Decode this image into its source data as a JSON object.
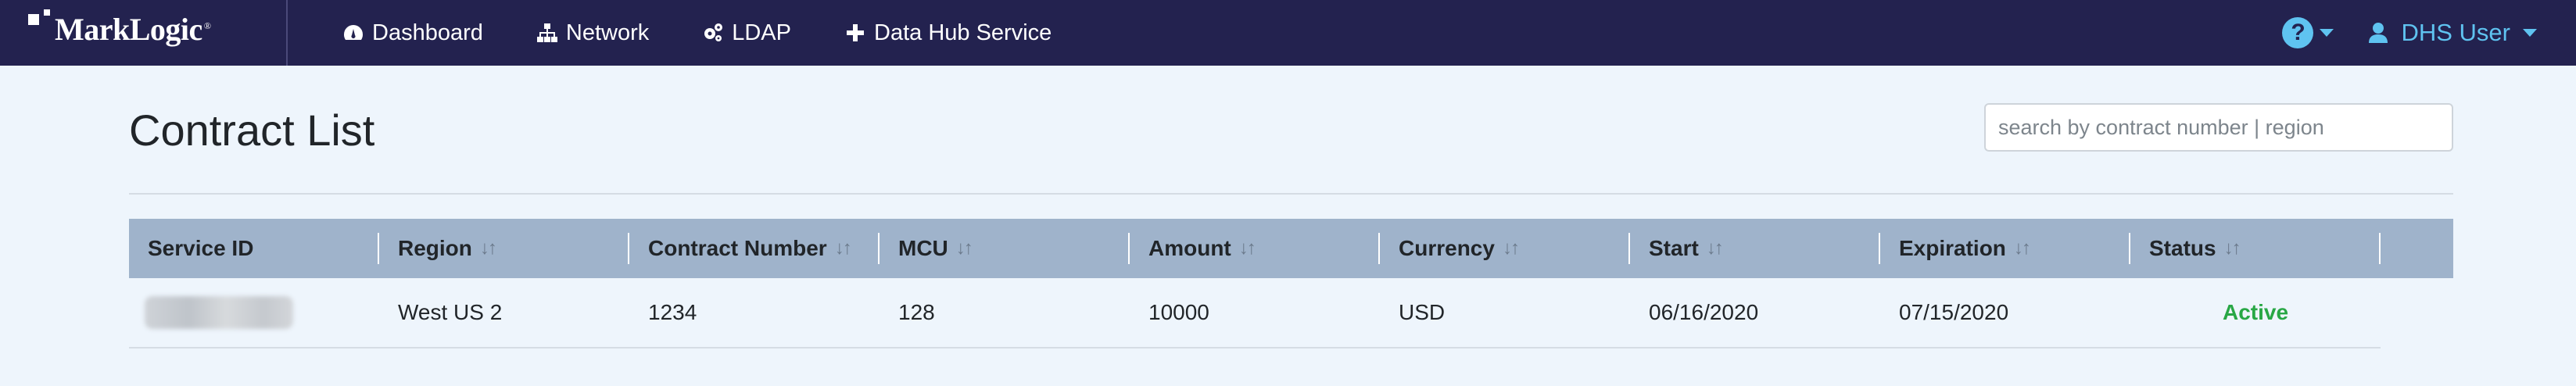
{
  "app": {
    "brand": "MarkLogic",
    "brand_mark": "®"
  },
  "nav": {
    "items": [
      {
        "label": "Dashboard",
        "icon": "tachometer-icon"
      },
      {
        "label": "Network",
        "icon": "sitemap-icon"
      },
      {
        "label": "LDAP",
        "icon": "cogs-icon"
      },
      {
        "label": "Data Hub Service",
        "icon": "plus-icon"
      }
    ],
    "help_icon": "question-circle-icon",
    "user_label": "DHS User",
    "user_icon": "user-icon"
  },
  "page": {
    "title": "Contract List",
    "search_placeholder": "search by contract number | region"
  },
  "table": {
    "sort_glyph": "↓↑",
    "columns": [
      {
        "label": "Service ID",
        "sortable": false
      },
      {
        "label": "Region",
        "sortable": true
      },
      {
        "label": "Contract Number",
        "sortable": true
      },
      {
        "label": "MCU",
        "sortable": true
      },
      {
        "label": "Amount",
        "sortable": true
      },
      {
        "label": "Currency",
        "sortable": true
      },
      {
        "label": "Start",
        "sortable": true
      },
      {
        "label": "Expiration",
        "sortable": true
      },
      {
        "label": "Status",
        "sortable": true
      }
    ],
    "rows": [
      {
        "service_id": "",
        "region": "West US 2",
        "contract_number": "1234",
        "mcu": "128",
        "amount": "10000",
        "currency": "USD",
        "start": "06/16/2020",
        "expiration": "07/15/2020",
        "status": "Active"
      }
    ]
  },
  "colors": {
    "navbar": "#23224f",
    "accent": "#5fc3f0",
    "table_header": "#9fb3cb",
    "status_active": "#28a745",
    "background": "#eef5fc"
  }
}
